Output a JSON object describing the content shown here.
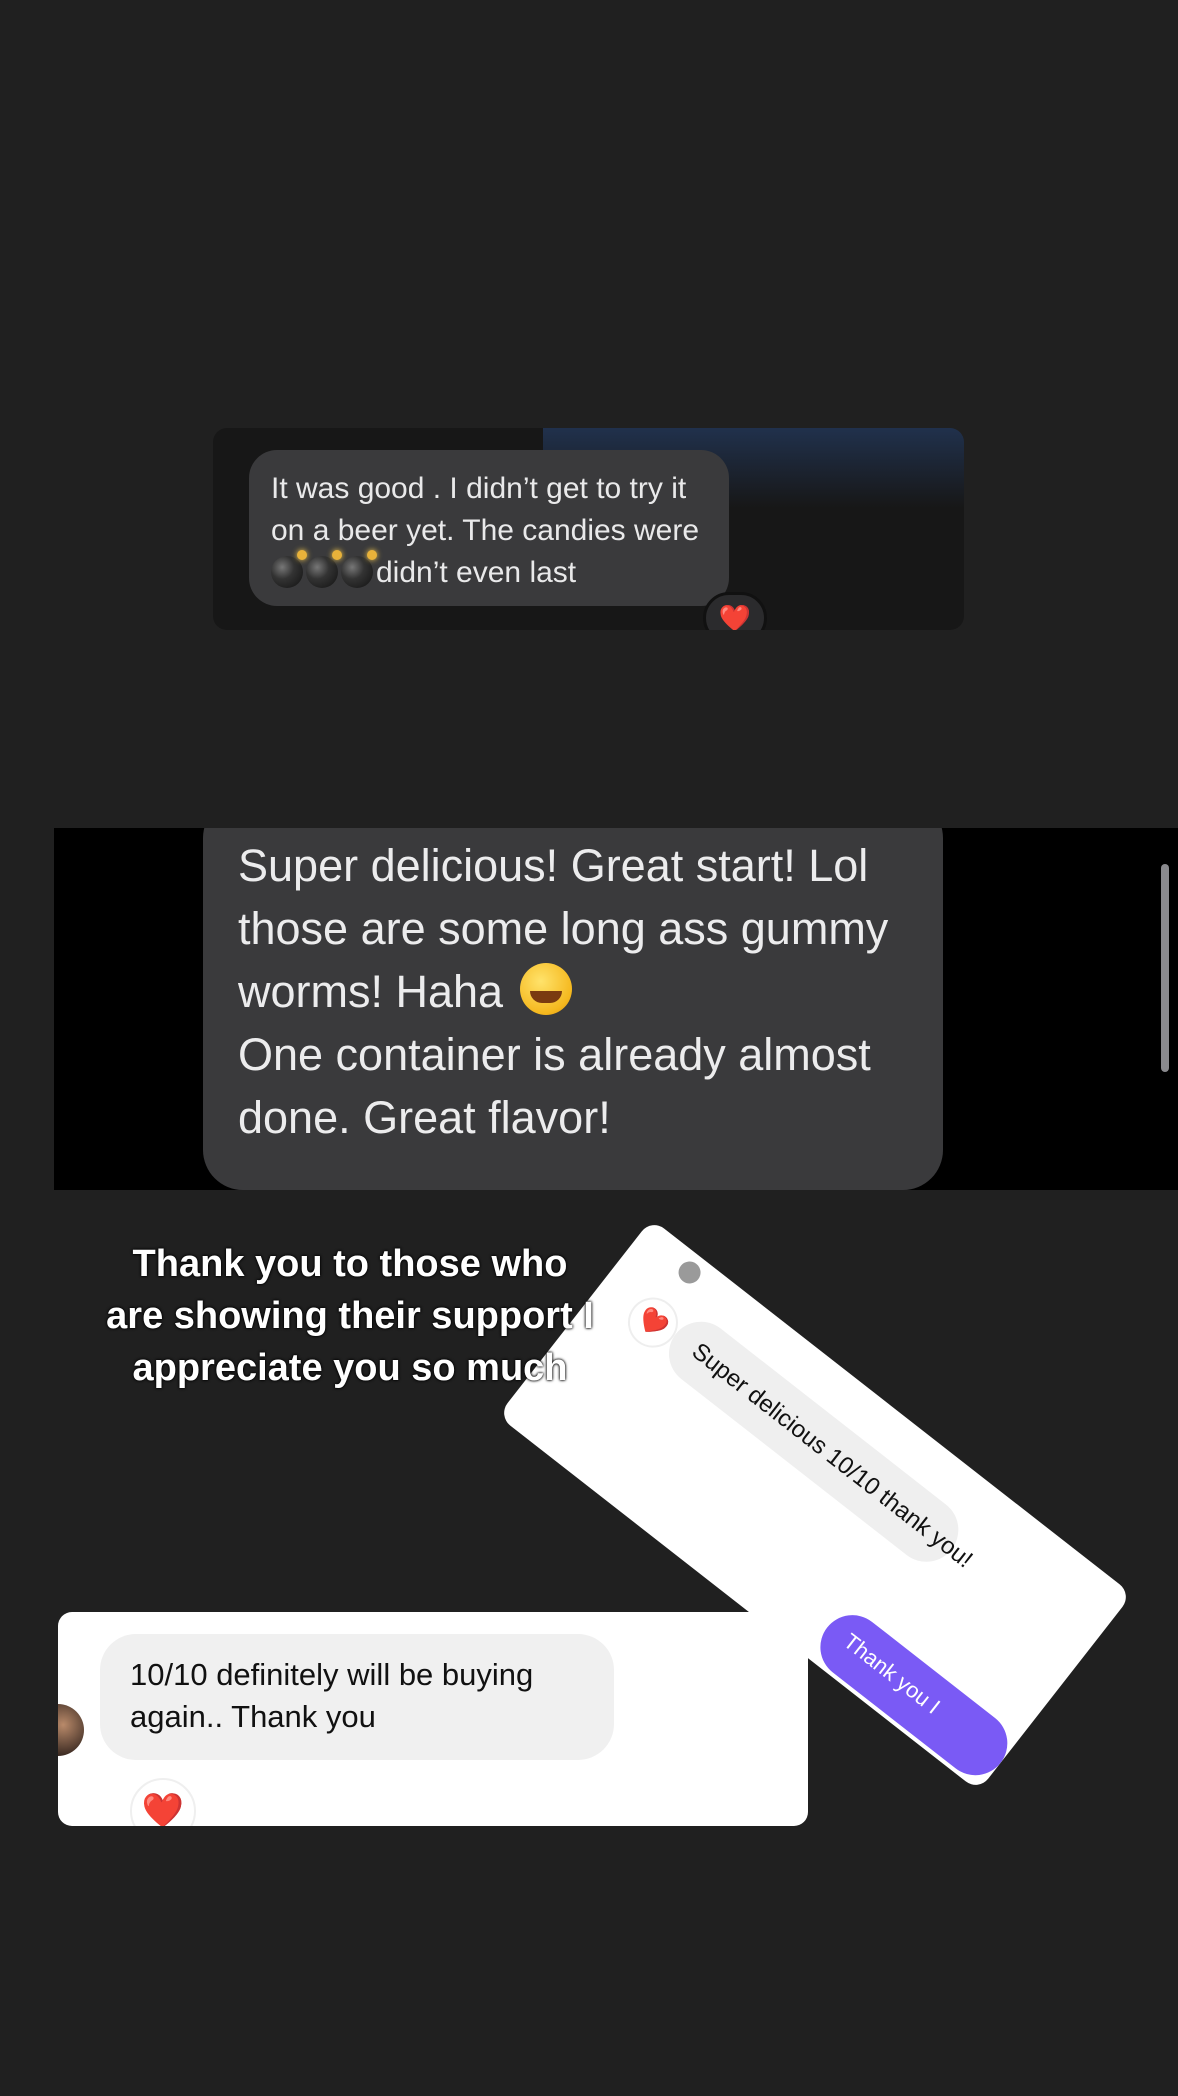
{
  "screenshot1": {
    "message_line1": "It was good . I didn’t get to try it",
    "message_line2": "on a beer yet. The candies were",
    "message_line3": "didn’t even last",
    "reaction": "❤️"
  },
  "screenshot2": {
    "message_line1": "Super delicious! Great start! Lol",
    "message_line2": "those are some long ass gummy",
    "message_line3": "worms! Haha",
    "message_line4": "One container is already almost",
    "message_line5": "done. Great flavor!"
  },
  "caption": {
    "line1": "Thank you to those who",
    "line2": "are showing their support I",
    "line3": "appreciate you so much"
  },
  "screenshot3": {
    "message": "Super delicious 10/10 thank you!",
    "reaction": "❤️",
    "sent_message": "Thank you I"
  },
  "screenshot4": {
    "message_line1": "10/10 definitely will be buying",
    "message_line2": "again.. Thank you",
    "reaction": "❤️"
  },
  "colors": {
    "background": "#202020",
    "incoming_bubble_dark": "#3a3a3c",
    "incoming_bubble_light": "#f0f0f0",
    "sent_bubble": "#7a5af5",
    "heart": "#e0242b"
  }
}
